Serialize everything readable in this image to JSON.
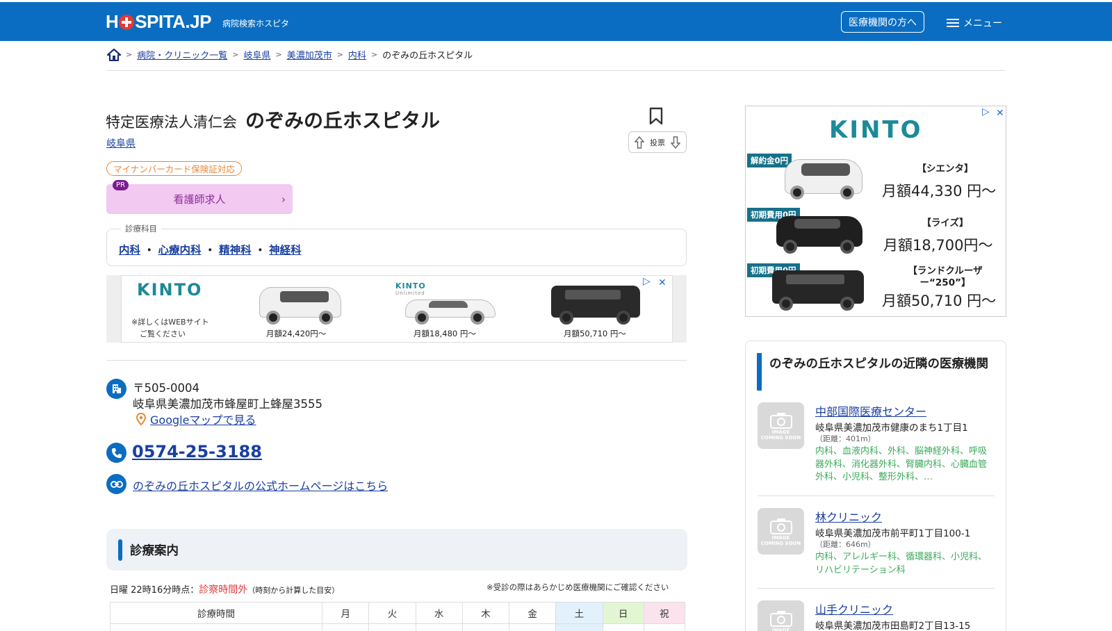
{
  "header": {
    "logo_text_1": "H",
    "logo_text_2": "SPITA.JP",
    "subtitle": "病院検索ホスピタ",
    "pro_button": "医療機関の方へ",
    "menu_label": "メニュー"
  },
  "breadcrumb": {
    "items": [
      "病院・クリニック一覧",
      "岐阜県",
      "美濃加茂市",
      "内科"
    ],
    "current": "のぞみの丘ホスピタル",
    "separator": ">"
  },
  "hospital": {
    "corp": "特定医療法人清仁会",
    "name": "のぞみの丘ホスピタル",
    "prefecture": "岐阜県",
    "vote_label": "投票",
    "mynumber_badge": "マイナンバーカード保険証対応",
    "nurse_pr": "PR",
    "nurse_label": "看護師求人",
    "dept_legend": "診療科目",
    "departments": [
      "内科",
      "心療内科",
      "精神科",
      "神経科"
    ],
    "dept_sep": "・",
    "zip": "〒505-0004",
    "address": "岐阜県美濃加茂市蜂屋町上蜂屋3555",
    "gmap_link": "Googleマップで見る",
    "phone": "0574-25-3188",
    "homepage_link": "のぞみの丘ホスピタルの公式ホームページはこちら"
  },
  "ad_main": {
    "brand": "KINTO",
    "brand_small": "KINTO",
    "brand_small_sub": "Unlimited",
    "note_1": "※詳しくはWEBサイト",
    "note_2": "ご覧ください",
    "prices": [
      "月額24,420円〜",
      "月額18,480 円〜",
      "月額50,710 円〜"
    ],
    "close": "✕",
    "adchoice": "▷"
  },
  "guidance": {
    "title": "診療案内",
    "status_prefix": "日曜 22時16分時点：",
    "status_value": "診察時間外",
    "status_note": "（時刻から計算した目安）",
    "confirm_note": "※受診の際はあらかじめ医療機関にご確認ください",
    "schedule_headers": [
      "診療時間",
      "月",
      "火",
      "水",
      "木",
      "金",
      "土",
      "日",
      "祝"
    ],
    "colors": {
      "sat": "#e3f1fc",
      "sun": "#e3f6d4",
      "hol": "#fbe3ee"
    }
  },
  "side_ad": {
    "brand": "KINTO",
    "tags": [
      "解約金0円",
      "初期費用0円",
      "初期費用0円"
    ],
    "models": [
      "【シエンタ】",
      "【ライズ】",
      "【ランドクルーザー“250”】"
    ],
    "prices": [
      "月額44,330 円〜",
      "月額18,700円〜",
      "月額50,710 円〜"
    ],
    "close": "✕",
    "adchoice": "▷"
  },
  "nearby": {
    "title": "のぞみの丘ホスピタルの近隣の医療機関",
    "thumb_text_1": "IMAGE",
    "thumb_text_2": "COMING SOON",
    "items": [
      {
        "name": "中部国際医療センター",
        "address": "岐阜県美濃加茂市健康のまち1丁目1",
        "distance": "（距離：401m）",
        "depts": "内科、血液内科、外科、脳神経外科、呼吸器外科、消化器外科、腎臓内科、心臓血管外科、小児科、整形外科、…"
      },
      {
        "name": "林クリニック",
        "address": "岐阜県美濃加茂市前平町1丁目100-1",
        "distance": "（距離：646m）",
        "depts": "内科、アレルギー科、循環器科、小児科、リハビリテーション科"
      },
      {
        "name": "山手クリニック",
        "address": "岐阜県美濃加茂市田島町2丁目13-15",
        "distance": "",
        "depts": ""
      }
    ]
  },
  "colors": {
    "brand_blue": "#0a6dc2",
    "link": "#1a3fa0",
    "kinto_teal": "#1b8a99",
    "dept_green": "#3aaa5a",
    "alert_red": "#e23b3b"
  }
}
